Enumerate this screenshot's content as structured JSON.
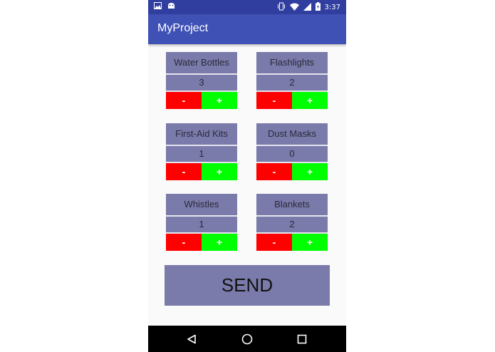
{
  "status_bar": {
    "time": "3:37",
    "left_icons": [
      "image-icon",
      "android-icon"
    ],
    "right_icons": [
      "vibrate-icon",
      "wifi-icon",
      "signal-icon",
      "battery-charging-icon"
    ]
  },
  "app_bar": {
    "title": "MyProject"
  },
  "items": [
    {
      "name": "Water Bottles",
      "count": "3",
      "minus_label": "-",
      "plus_label": "+"
    },
    {
      "name": "Flashlights",
      "count": "2",
      "minus_label": "-",
      "plus_label": "+"
    },
    {
      "name": "First-Aid Kits",
      "count": "1",
      "minus_label": "-",
      "plus_label": "+"
    },
    {
      "name": "Dust Masks",
      "count": "0",
      "minus_label": "-",
      "plus_label": "+"
    },
    {
      "name": "Whistles",
      "count": "1",
      "minus_label": "-",
      "plus_label": "+"
    },
    {
      "name": "Blankets",
      "count": "2",
      "minus_label": "-",
      "plus_label": "+"
    }
  ],
  "send_button": {
    "label": "SEND"
  },
  "nav_bar": {
    "buttons": [
      "back-icon",
      "home-icon",
      "recents-icon"
    ]
  },
  "colors": {
    "status_bar": "#303f9f",
    "app_bar": "#3f51b5",
    "item_bg": "#7a7aab",
    "minus": "#ff0000",
    "plus": "#00ff00"
  }
}
